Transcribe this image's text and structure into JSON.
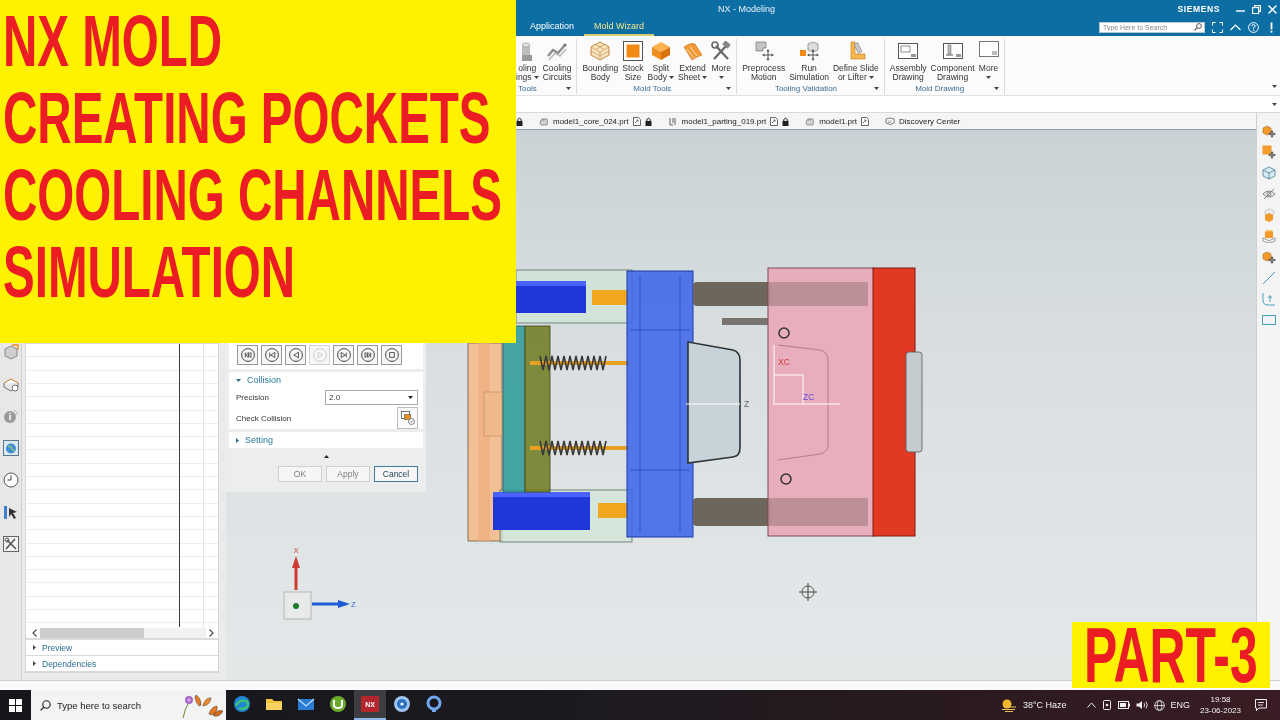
{
  "overlay": {
    "title_lines": [
      "NX MOLD",
      "CREATING POCKETS",
      "COOLING CHANNELS",
      "SIMULATION"
    ],
    "part_label": "PART-3"
  },
  "window": {
    "title": "NX - Modeling",
    "brand": "SIEMENS"
  },
  "menu_tabs": [
    {
      "label": "Application",
      "selected": false
    },
    {
      "label": "Mold Wizard",
      "selected": true
    }
  ],
  "search": {
    "placeholder": "Type Here to Search"
  },
  "ribbon": {
    "groups": [
      {
        "label": "Tools",
        "has_menu": true,
        "buttons": [
          {
            "label_lines": [
              "oling",
              "ings"
            ],
            "has_menu": true
          },
          {
            "label_lines": [
              "Cooling",
              "Circuits"
            ],
            "has_menu": false
          }
        ]
      },
      {
        "label": "Mold Tools",
        "has_menu": true,
        "buttons": [
          {
            "label_lines": [
              "Bounding",
              "Body"
            ],
            "has_menu": false
          },
          {
            "label_lines": [
              "Stock",
              "Size"
            ],
            "has_menu": false
          },
          {
            "label_lines": [
              "Split",
              "Body"
            ],
            "has_menu": true
          },
          {
            "label_lines": [
              "Extend",
              "Sheet"
            ],
            "has_menu": true
          },
          {
            "label_lines": [
              "More"
            ],
            "has_menu": true
          }
        ]
      },
      {
        "label": "Tooling Validation",
        "has_menu": true,
        "buttons": [
          {
            "label_lines": [
              "Preprocess",
              "Motion"
            ],
            "has_menu": false
          },
          {
            "label_lines": [
              "Run",
              "Simulation"
            ],
            "has_menu": false
          },
          {
            "label_lines": [
              "Define Slide",
              "or Lifter"
            ],
            "has_menu": true
          }
        ]
      },
      {
        "label": "Mold Drawing",
        "has_menu": true,
        "buttons": [
          {
            "label_lines": [
              "Assembly",
              "Drawing"
            ],
            "has_menu": false
          },
          {
            "label_lines": [
              "Component",
              "Drawing"
            ],
            "has_menu": false
          },
          {
            "label_lines": [
              "More"
            ],
            "has_menu": true
          }
        ]
      }
    ]
  },
  "file_tabs": [
    {
      "kind": "partial",
      "locked": true
    },
    {
      "kind": "part",
      "label": "model1_core_024.prt",
      "locked": true
    },
    {
      "kind": "parting",
      "label": "model1_parting_019.prt",
      "locked": true
    },
    {
      "kind": "part",
      "label": "model1.prt",
      "locked": false
    },
    {
      "kind": "page",
      "label": "Discovery Center",
      "locked": false
    }
  ],
  "navigator": {
    "sections": [
      {
        "title": "Preview",
        "expanded": false
      },
      {
        "title": "Dependencies",
        "expanded": false
      }
    ]
  },
  "dialog": {
    "playback": [
      {
        "disabled": false
      },
      {
        "disabled": false
      },
      {
        "disabled": false
      },
      {
        "disabled": true
      },
      {
        "disabled": false
      },
      {
        "disabled": false
      },
      {
        "disabled": false
      }
    ],
    "sections": [
      {
        "title": "Collision",
        "expanded": true,
        "fields": [
          {
            "kind": "dropdown",
            "label": "Precision",
            "value": "2.0"
          },
          {
            "kind": "action",
            "label": "Check Collision"
          }
        ]
      },
      {
        "title": "Setting",
        "expanded": false
      }
    ],
    "buttons": [
      {
        "label": "OK",
        "disabled": true
      },
      {
        "label": "Apply",
        "disabled": true
      },
      {
        "label": "Cancel",
        "disabled": false
      }
    ]
  },
  "viewport": {
    "model_labels": [
      {
        "text": "Z",
        "kind": "absolute"
      },
      {
        "text": "XC",
        "kind": "wcs_x"
      },
      {
        "text": "ZC",
        "kind": "wcs_z"
      }
    ],
    "triad": {
      "x_label": "X",
      "z_label": "Z"
    }
  },
  "taskbar": {
    "search_placeholder": "Type here to search",
    "apps": [
      {
        "active": false
      },
      {
        "active": false
      },
      {
        "active": false
      },
      {
        "active": false
      },
      {
        "label": "NX",
        "active": true
      },
      {
        "active": false
      },
      {
        "active": false
      }
    ],
    "weather": "38°C Haze",
    "language": "ENG",
    "time": "19:58",
    "date": "23-06-2023"
  }
}
